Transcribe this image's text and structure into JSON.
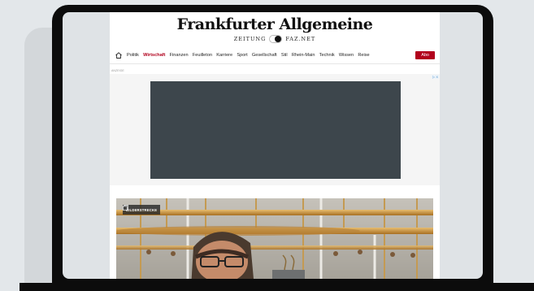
{
  "masthead": {
    "logo": "Frankfurter Allgemeine",
    "zeitung": "ZEITUNG",
    "faznet": "FAZ.NET"
  },
  "nav": {
    "items": [
      {
        "label": "Politik",
        "active": false
      },
      {
        "label": "Wirtschaft",
        "active": true
      },
      {
        "label": "Finanzen",
        "active": false
      },
      {
        "label": "Feuilleton",
        "active": false
      },
      {
        "label": "Karriere",
        "active": false
      },
      {
        "label": "Sport",
        "active": false
      },
      {
        "label": "Gesellschaft",
        "active": false
      },
      {
        "label": "Stil",
        "active": false
      },
      {
        "label": "Rhein-Main",
        "active": false
      },
      {
        "label": "Technik",
        "active": false
      },
      {
        "label": "Wissen",
        "active": false
      },
      {
        "label": "Reise",
        "active": false
      }
    ],
    "abo_label": "Abo"
  },
  "ad": {
    "label": "ANZEIGE",
    "choices": "▷ X"
  },
  "hero": {
    "badge_label": "BILDERSTRECKE"
  },
  "colors": {
    "accent": "#b1001c",
    "ad_placeholder": "#3d464c"
  },
  "icons": {
    "home": "home-icon",
    "gallery": "gallery-icon"
  }
}
